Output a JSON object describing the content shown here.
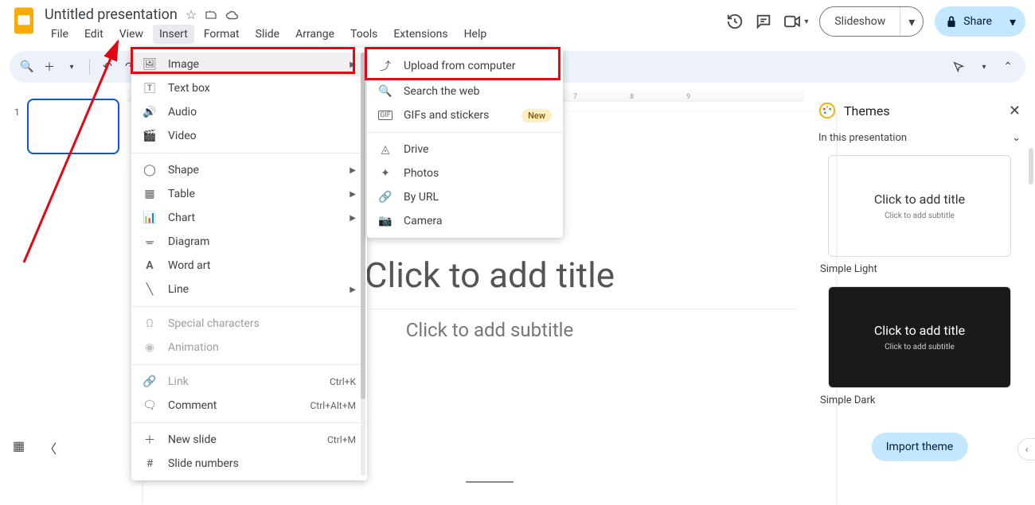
{
  "header": {
    "doc_title": "Untitled presentation",
    "menu": {
      "file": "File",
      "edit": "Edit",
      "view": "View",
      "insert": "Insert",
      "format": "Format",
      "slide": "Slide",
      "arrange": "Arrange",
      "tools": "Tools",
      "extensions": "Extensions",
      "help": "Help"
    },
    "slideshow_label": "Slideshow",
    "share_label": "Share"
  },
  "insert_menu": {
    "image": "Image",
    "text_box": "Text box",
    "audio": "Audio",
    "video": "Video",
    "shape": "Shape",
    "table": "Table",
    "chart": "Chart",
    "diagram": "Diagram",
    "word_art": "Word art",
    "line": "Line",
    "special_chars": "Special characters",
    "animation": "Animation",
    "link": "Link",
    "link_k": "Ctrl+K",
    "comment": "Comment",
    "comment_k": "Ctrl+Alt+M",
    "new_slide": "New slide",
    "new_slide_k": "Ctrl+M",
    "slide_numbers": "Slide numbers"
  },
  "image_submenu": {
    "upload": "Upload from computer",
    "search": "Search the web",
    "gifs": "GIFs and stickers",
    "new_badge": "New",
    "drive": "Drive",
    "photos": "Photos",
    "by_url": "By URL",
    "camera": "Camera"
  },
  "filmstrip": {
    "slide_number": "1"
  },
  "canvas": {
    "title_placeholder": "Click to add title",
    "subtitle_placeholder": "Click to add subtitle"
  },
  "ruler": {
    "t7": "7",
    "t8": "8",
    "t9": "9"
  },
  "themes": {
    "header": "Themes",
    "in_presentation": "In this presentation",
    "light_title": "Click to add title",
    "light_sub": "Click to add subtitle",
    "light_name": "Simple Light",
    "dark_title": "Click to add title",
    "dark_sub": "Click to add subtitle",
    "dark_name": "Simple Dark",
    "import": "Import theme"
  }
}
